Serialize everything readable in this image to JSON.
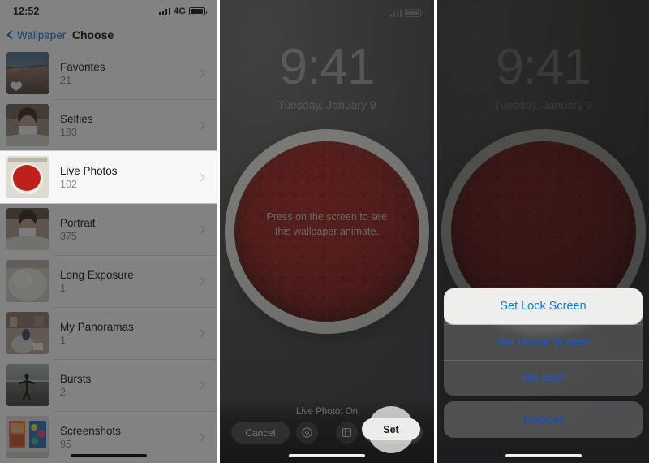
{
  "panel1": {
    "statusbar": {
      "time": "12:52",
      "network": "4G",
      "signal_icon": "signal-bars-icon",
      "battery_icon": "battery-icon"
    },
    "navbar": {
      "back_label": "Wallpaper",
      "back_icon": "chevron-left-icon",
      "title": "Choose"
    },
    "albums": [
      {
        "title": "Favorites",
        "count": "21",
        "thumb": "street-scene-with-heart"
      },
      {
        "title": "Selfies",
        "count": "183",
        "thumb": "person-wearing-mask"
      },
      {
        "title": "Live Photos",
        "count": "102",
        "thumb": "red-powder-bowl",
        "highlighted": true
      },
      {
        "title": "Portrait",
        "count": "375",
        "thumb": "person-portrait"
      },
      {
        "title": "Long Exposure",
        "count": "1",
        "thumb": "white-cloth-blur"
      },
      {
        "title": "My Panoramas",
        "count": "1",
        "thumb": "indoor-panorama"
      },
      {
        "title": "Bursts",
        "count": "2",
        "thumb": "beach-silhouette"
      },
      {
        "title": "Screenshots",
        "count": "95",
        "thumb": "two-colorful-screens"
      }
    ],
    "chevron_icon": "chevron-right-icon",
    "home_indicator": "home-indicator"
  },
  "panel2": {
    "lockscreen": {
      "time": "9:41",
      "date": "Tuesday, January 9",
      "hint_line1": "Press on the screen to see",
      "hint_line2": "this wallpaper animate."
    },
    "toolbar": {
      "live_label": "Live Photo: On",
      "cancel_label": "Cancel",
      "still_icon": "still-photo-icon",
      "perspective_icon": "perspective-zoom-icon",
      "set_label": "Set"
    },
    "cursor": "tap-highlight-ring"
  },
  "panel3": {
    "lockscreen": {
      "time": "9:41",
      "date": "Tuesday, January 9"
    },
    "action_sheet": {
      "options": [
        {
          "label": "Set Lock Screen",
          "highlighted": true
        },
        {
          "label": "Set Home Screen",
          "highlighted": false
        },
        {
          "label": "Set Both",
          "highlighted": false
        }
      ],
      "cancel_label": "Cancel"
    }
  },
  "colors": {
    "ios_blue": "#0a6cd8",
    "sheet_blue": "#1b59c6",
    "highlight_blue": "#0a7bf0",
    "wallpaper_red": "#97201c",
    "highlight_bg": "#f7f7f7"
  }
}
